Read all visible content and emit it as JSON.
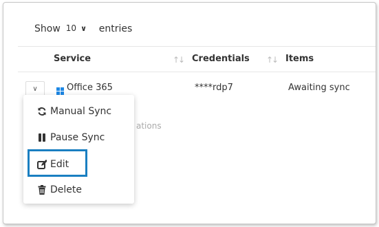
{
  "length_menu": {
    "show_label": "Show",
    "selected": "10",
    "entries_label": "entries"
  },
  "columns": [
    {
      "label": "Service"
    },
    {
      "label": "Credentials"
    },
    {
      "label": "Items"
    }
  ],
  "row": {
    "service": "Office 365",
    "credentials": "****rdp7",
    "items": "Awaiting sync",
    "partial_text": "ations"
  },
  "action_menu": {
    "items": [
      {
        "label": "Manual Sync",
        "icon": "refresh-icon"
      },
      {
        "label": "Pause Sync",
        "icon": "pause-icon"
      },
      {
        "label": "Edit",
        "icon": "edit-icon"
      },
      {
        "label": "Delete",
        "icon": "trash-icon"
      }
    ]
  },
  "colors": {
    "highlight": "#1a7fc1",
    "ms_logo": "#1e88e5"
  }
}
